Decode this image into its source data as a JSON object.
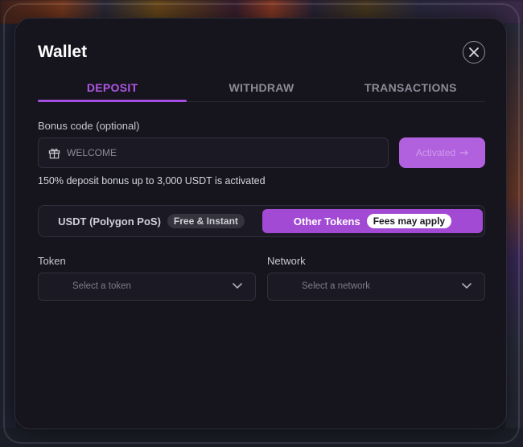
{
  "modal": {
    "title": "Wallet"
  },
  "tabs": [
    {
      "label": "DEPOSIT",
      "active": true
    },
    {
      "label": "WITHDRAW",
      "active": false
    },
    {
      "label": "TRANSACTIONS",
      "active": false
    }
  ],
  "bonus": {
    "label": "Bonus code (optional)",
    "input_value": "WELCOME",
    "button_label": "Activated",
    "button_icon": "arrow-right-icon",
    "status_text": "150% deposit bonus up to 3,000 USDT is activated"
  },
  "network_toggle": {
    "left_label": "USDT (Polygon PoS)",
    "left_badge": "Free & Instant",
    "right_label": "Other Tokens",
    "right_badge": "Fees may apply",
    "selected": "right"
  },
  "token": {
    "label": "Token",
    "placeholder": "Select a token"
  },
  "network": {
    "label": "Network",
    "placeholder": "Select a network"
  },
  "colors": {
    "accent": "#a54fe0",
    "modal_bg": "#16151e",
    "active_toggle": "#a24ad4"
  }
}
